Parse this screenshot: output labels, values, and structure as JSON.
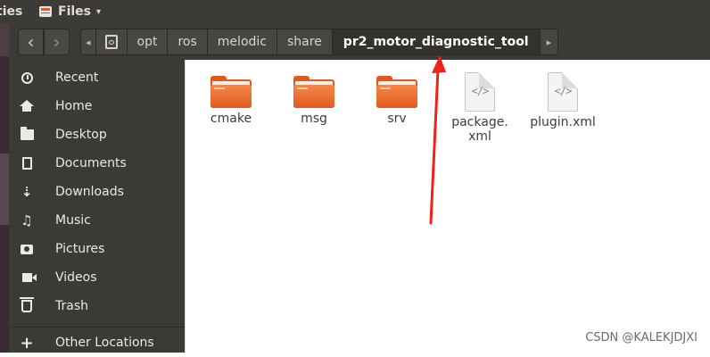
{
  "top_panel": {
    "activities_label": "ties",
    "app_menu_label": "Files",
    "app_menu_caret": "▾"
  },
  "header": {
    "back_icon": "‹",
    "forward_icon": "›",
    "breadcrumb_left_arrow": "◂",
    "breadcrumb_right_arrow": "▸",
    "breadcrumbs": [
      "opt",
      "ros",
      "melodic",
      "share",
      "pr2_motor_diagnostic_tool"
    ],
    "active_crumb": "pr2_motor_diagnostic_tool"
  },
  "sidebar": {
    "items": [
      {
        "label": "Recent",
        "icon": "clock-icon"
      },
      {
        "label": "Home",
        "icon": "home-icon"
      },
      {
        "label": "Desktop",
        "icon": "folder-icon"
      },
      {
        "label": "Documents",
        "icon": "document-icon"
      },
      {
        "label": "Downloads",
        "icon": "download-icon"
      },
      {
        "label": "Music",
        "icon": "music-icon"
      },
      {
        "label": "Pictures",
        "icon": "camera-icon"
      },
      {
        "label": "Videos",
        "icon": "video-icon"
      },
      {
        "label": "Trash",
        "icon": "trash-icon"
      },
      {
        "label": "Other Locations",
        "icon": "plus-icon"
      }
    ],
    "glyphs": {
      "download": "⇣",
      "music": "♫",
      "plus": "+"
    }
  },
  "content": {
    "files": [
      {
        "name": "cmake",
        "type": "folder"
      },
      {
        "name": "msg",
        "type": "folder"
      },
      {
        "name": "srv",
        "type": "folder"
      },
      {
        "name_line1": "package.",
        "name_line2": "xml",
        "type": "xml"
      },
      {
        "name": "plugin.xml",
        "type": "xml"
      }
    ],
    "xml_glyph": "</>"
  },
  "annotation": {
    "arrow_color": "#f0201c"
  },
  "watermark": "CSDN @KALEKJDJXI"
}
